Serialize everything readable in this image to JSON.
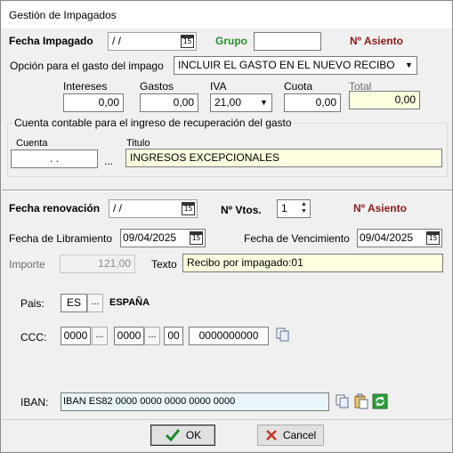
{
  "window": {
    "title": "Gestión de Impagados"
  },
  "impagado": {
    "fecha_label": "Fecha Impagado",
    "fecha_value": " /  /",
    "grupo_label": "Grupo",
    "grupo_value": "",
    "asiento_label": "Nº Asiento"
  },
  "gasto": {
    "opcion_label": "Opción para el gasto del impago",
    "opcion_value": "INCLUIR EL GASTO EN EL NUEVO RECIBO",
    "intereses_label": "Intereses",
    "intereses_value": "0,00",
    "gastos_label": "Gastos",
    "gastos_value": "0,00",
    "iva_label": "IVA",
    "iva_value": "21,00",
    "cuota_label": "Cuota",
    "cuota_value": "0,00",
    "total_label": "Total",
    "total_value": "0,00"
  },
  "cuenta_group": {
    "title": "Cuenta contable para el ingreso de recuperación del gasto",
    "cuenta_label": "Cuenta",
    "cuenta_value": ". .",
    "ellipsis": "...",
    "titulo_label": "Titulo",
    "titulo_value": "INGRESOS EXCEPCIONALES"
  },
  "renovacion": {
    "fecha_label": "Fecha renovación",
    "fecha_value": " /  /",
    "vtos_label": "Nº Vtos.",
    "vtos_value": "1",
    "asiento_label": "Nº Asiento",
    "libramiento_label": "Fecha de Libramiento",
    "libramiento_value": "09/04/2025",
    "vencimiento_label": "Fecha de Vencimiento",
    "vencimiento_value": "09/04/2025",
    "importe_label": "Importe",
    "importe_value": "121,00",
    "texto_label": "Texto",
    "texto_value": "Recibo por impagado:01"
  },
  "banco": {
    "pais_label": "Pais:",
    "pais_code": "ES",
    "pais_name": "ESPAÑA",
    "ellipsis": "...",
    "ccc_label": "CCC:",
    "ccc_entidad": "0000",
    "ccc_oficina": "0000",
    "ccc_dc": "00",
    "ccc_cuenta": "0000000000",
    "iban_label": "IBAN:",
    "iban_value": "IBAN ES82 0000 0000 0000 0000 0000"
  },
  "footer": {
    "ok_label": "OK",
    "cancel_label": "Cancel"
  },
  "icons": {
    "calendar": "calendar-icon",
    "copy": "copy-icon",
    "paste": "paste-icon",
    "refresh": "refresh-icon",
    "ok": "checkmark-icon",
    "cancel": "cross-icon"
  }
}
